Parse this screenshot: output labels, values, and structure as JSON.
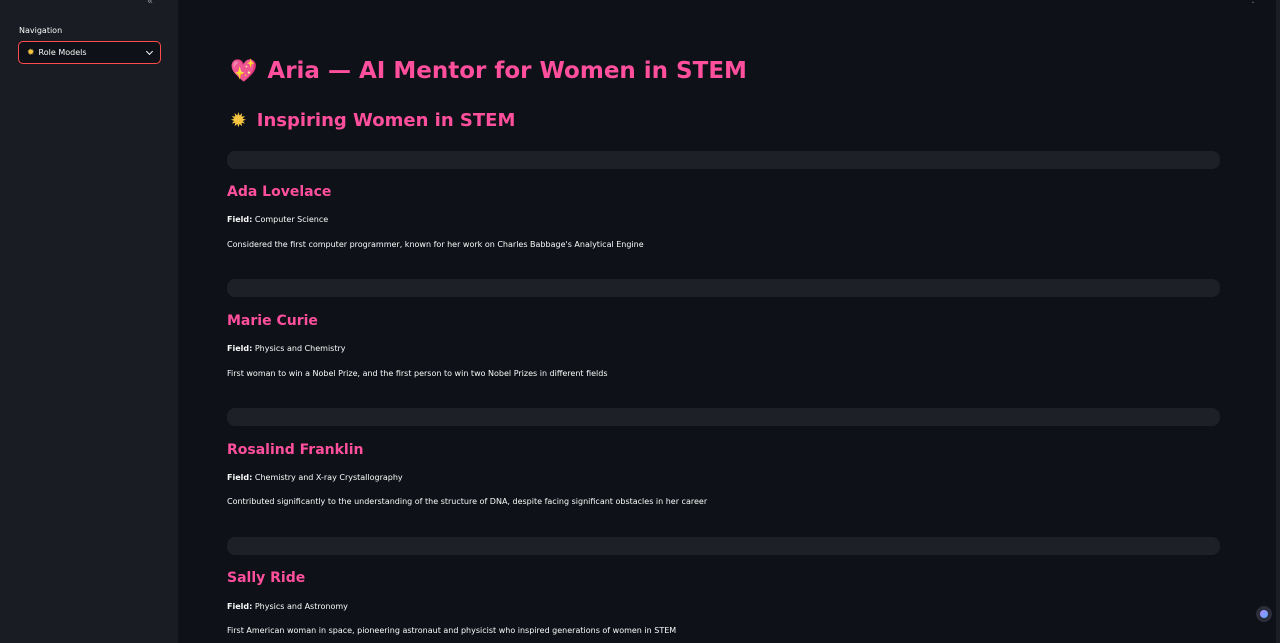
{
  "sidebar": {
    "collapse_glyph": "«",
    "nav_label": "Navigation",
    "select": {
      "icon": "sun-icon",
      "value": "Role Models"
    }
  },
  "main": {
    "menu_glyph": "⋮",
    "title": "Aria — AI Mentor for Women in STEM",
    "title_icon": "sparkling-heart-icon",
    "subtitle": "Inspiring Women in STEM",
    "subtitle_icon": "sun-icon",
    "field_label": "Field:",
    "role_models": [
      {
        "name": "Ada Lovelace",
        "field": "Computer Science",
        "description": "Considered the first computer programmer, known for her work on Charles Babbage's Analytical Engine"
      },
      {
        "name": "Marie Curie",
        "field": "Physics and Chemistry",
        "description": "First woman to win a Nobel Prize, and the first person to win two Nobel Prizes in different fields"
      },
      {
        "name": "Rosalind Franklin",
        "field": "Chemistry and X-ray Crystallography",
        "description": "Contributed significantly to the understanding of the structure of DNA, despite facing significant obstacles in her career"
      },
      {
        "name": "Sally Ride",
        "field": "Physics and Astronomy",
        "description": "First American woman in space, pioneering astronaut and physicist who inspired generations of women in STEM"
      }
    ]
  },
  "colors": {
    "accent": "#ff4f9d",
    "select_border": "#ff4b4b",
    "background": "#0e1117",
    "sidebar": "#1a1c23"
  }
}
